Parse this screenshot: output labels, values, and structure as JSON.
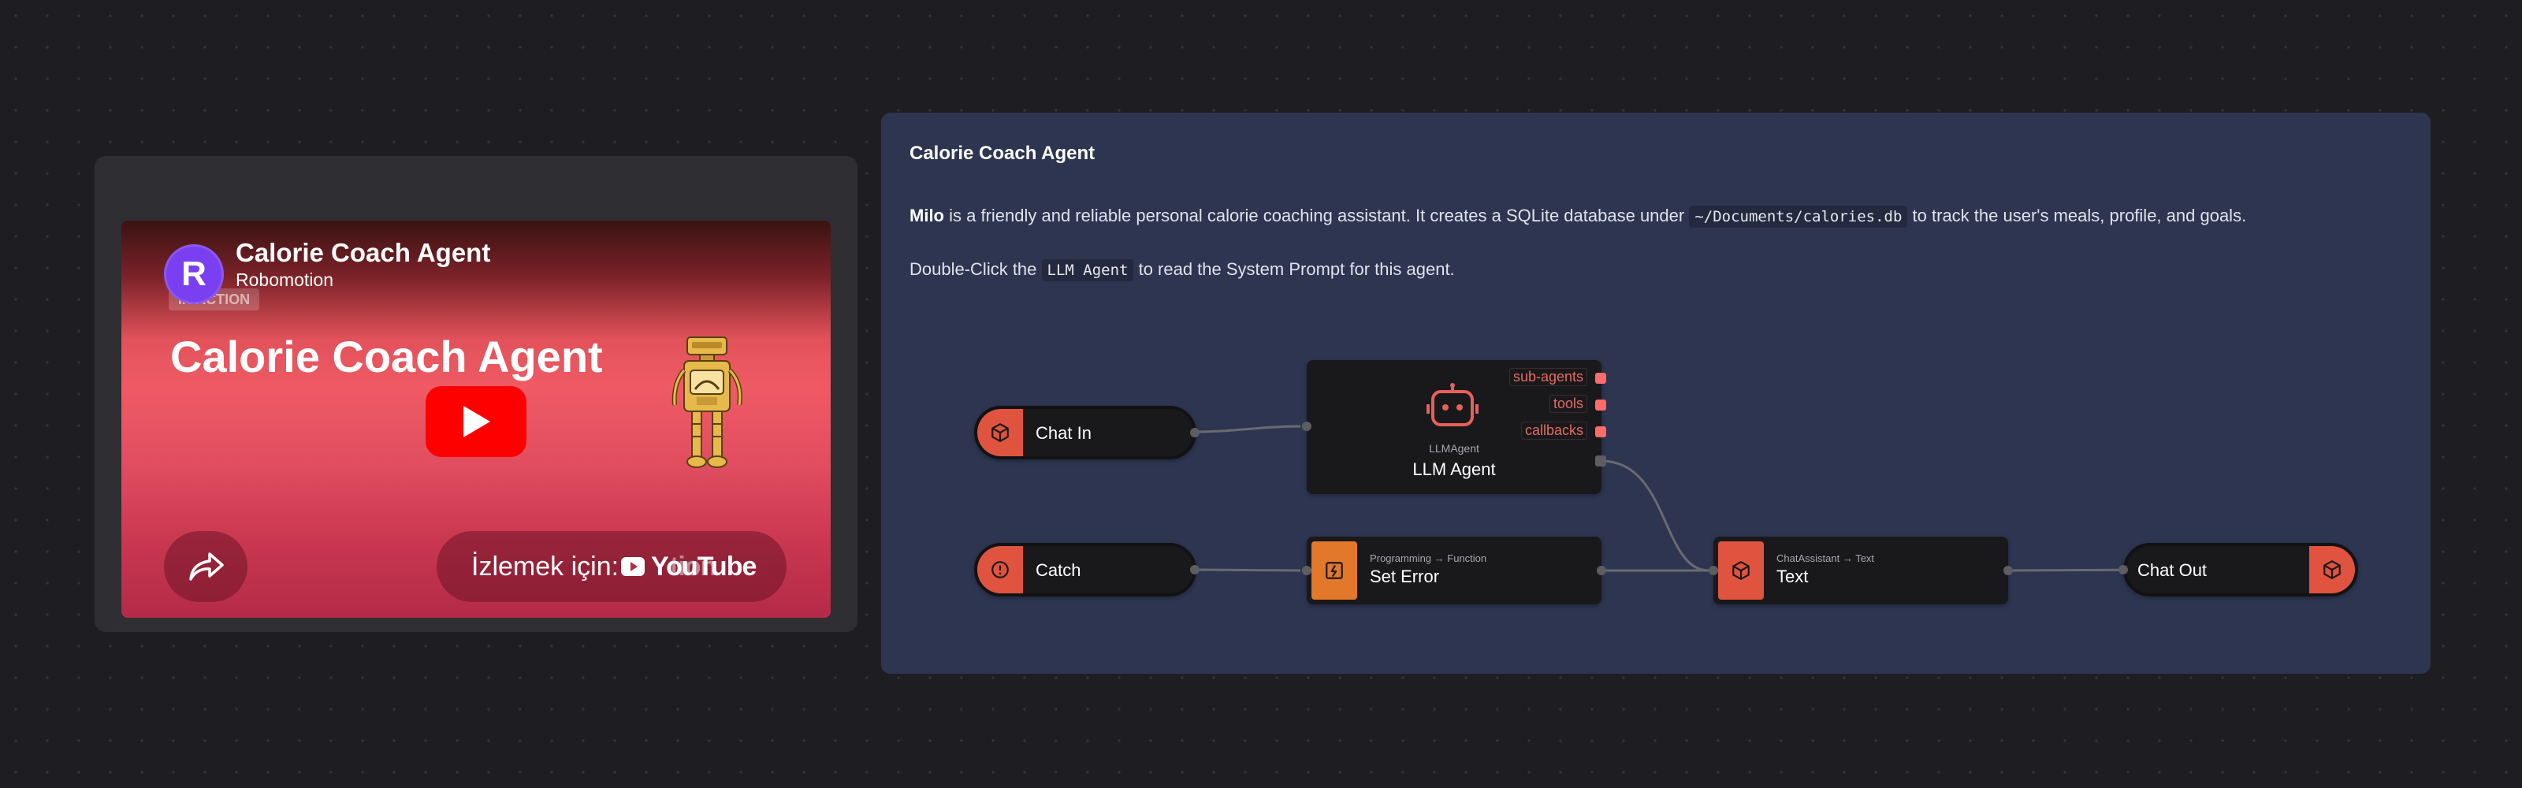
{
  "video": {
    "title": "Calorie Coach Agent",
    "channel": "Robomotion",
    "avatar_letter": "R",
    "badge": "IN ACTION",
    "thumbnail_heading": "Calorie Coach Agent",
    "watch_text": "İzlemek için:",
    "youtube_wordmark": "YouTube",
    "youtube_ghost": "tion",
    "colors": {
      "play": "#ff0000",
      "avatar": "#7a3ff0"
    }
  },
  "panel": {
    "title": "Calorie Coach Agent",
    "desc1": {
      "bold": "Milo",
      "text_a": " is a friendly and reliable personal calorie coaching assistant. It creates a SQLite database under ",
      "code": "~/Documents/calories.db",
      "text_b": " to track the user's meals, profile, and goals."
    },
    "desc2": {
      "text_a": "Double-Click the ",
      "code": "LLM Agent",
      "text_b": " to read the System Prompt for this agent."
    }
  },
  "flow": {
    "nodes": {
      "chat_in": {
        "label": "Chat In",
        "icon": "cube-icon",
        "color": "#e0533f"
      },
      "llm_agent": {
        "type": "LLMAgent",
        "label": "LLM Agent",
        "icon": "robot-icon",
        "color": "#e8605a",
        "slots": [
          "sub-agents",
          "tools",
          "callbacks"
        ]
      },
      "catch": {
        "label": "Catch",
        "icon": "alert-circle-icon",
        "color": "#e0533f"
      },
      "set_error": {
        "category": "Programming → Function",
        "label": "Set Error",
        "icon": "function-icon",
        "color": "#e2782a"
      },
      "text": {
        "category": "ChatAssistant → Text",
        "label": "Text",
        "icon": "cube-icon",
        "color": "#e0533f"
      },
      "chat_out": {
        "label": "Chat Out",
        "icon": "cube-icon",
        "color": "#e0533f"
      }
    }
  }
}
